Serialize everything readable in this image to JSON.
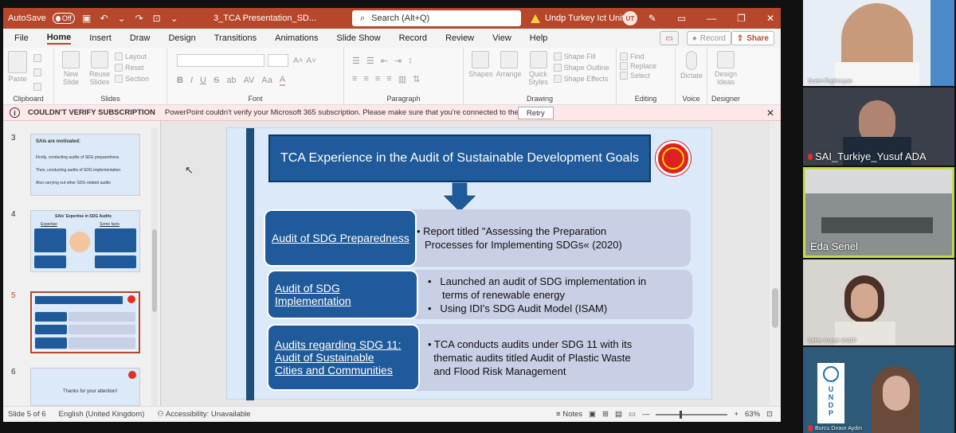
{
  "titlebar": {
    "autosave_label": "AutoSave",
    "autosave_state": "Off",
    "doc_title": "3_TCA Presentation_SD...",
    "search_placeholder": "Search (Alt+Q)",
    "org_label": "Undp Turkey Ict Unit",
    "user_initials": "UT"
  },
  "menu": {
    "items": [
      "File",
      "Home",
      "Insert",
      "Draw",
      "Design",
      "Transitions",
      "Animations",
      "Slide Show",
      "Record",
      "Review",
      "View",
      "Help"
    ],
    "active": "Home",
    "record_label": "Record",
    "share_label": "Share"
  },
  "ribbon": {
    "clipboard": {
      "label": "Clipboard",
      "paste": "Paste"
    },
    "slides": {
      "label": "Slides",
      "new_slide": "New Slide",
      "reuse_slides": "Reuse Slides",
      "layout": "Layout",
      "reset": "Reset",
      "section": "Section"
    },
    "font": {
      "label": "Font",
      "buttons": [
        "B",
        "I",
        "U",
        "S",
        "ab",
        "AV",
        "Aa",
        "A"
      ]
    },
    "paragraph": {
      "label": "Paragraph"
    },
    "drawing": {
      "label": "Drawing",
      "shapes": "Shapes",
      "arrange": "Arrange",
      "quick_styles": "Quick Styles",
      "shape_fill": "Shape Fill",
      "shape_outline": "Shape Outline",
      "shape_effects": "Shape Effects"
    },
    "editing": {
      "label": "Editing",
      "find": "Find",
      "replace": "Replace",
      "select": "Select"
    },
    "voice": {
      "label": "Voice",
      "dictate": "Dictate"
    },
    "designer": {
      "label": "Designer",
      "design_ideas": "Design Ideas"
    }
  },
  "notice": {
    "title": "COULDN'T VERIFY SUBSCRIPTION",
    "message": "PowerPoint couldn't verify your Microsoft 365 subscription. Please make sure that you're connected to the Internet.",
    "retry_label": "Retry"
  },
  "thumbnails": [
    {
      "num": "3",
      "title": "SAIs are motivated:",
      "lines": [
        "Firstly, conducting audits of SDG preparedness",
        "Then, conducting audits of SDG implementation",
        "Also carrying out other SDG-related audits"
      ]
    },
    {
      "num": "4",
      "title": "SAIs' Expertise in SDG Audits",
      "lines": [
        "Expertise",
        "Some facts"
      ]
    },
    {
      "num": "5",
      "title": "TCA Experience in the Audit of Sustainable Development Goals",
      "lines": []
    },
    {
      "num": "6",
      "title": "Thanks for your attention!",
      "lines": []
    }
  ],
  "selected_slide": "5",
  "slide": {
    "title": "TCA Experience in the Audit of Sustainable Development Goals",
    "rows": [
      {
        "label": "Audit of SDG Preparedness",
        "content": [
          "• Report titled \"Assessing the Preparation",
          "Processes for Implementing SDGs« (2020)"
        ]
      },
      {
        "label": "Audit of SDG Implementation",
        "content": [
          "•   Launched an audit of SDG implementation in",
          "     terms of renewable energy",
          "•   Using IDI's SDG Audit Model (ISAM)"
        ]
      },
      {
        "label_lines": [
          "Audits regarding SDG 11:",
          "Audit of Sustainable",
          "Cities and Communities"
        ],
        "content": [
          "• TCA conducts audits under SDG 11 with its",
          "  thematic audits titled Audit of Plastic Waste",
          "  and Flood Risk Management"
        ]
      }
    ]
  },
  "status": {
    "slide_counter": "Slide 5 of 6",
    "language": "English (United Kingdom)",
    "accessibility": "Accessibility: Unavailable",
    "notes": "Notes",
    "zoom": "63%"
  },
  "participants": [
    {
      "name": "Suren Poghosyan",
      "muted": false
    },
    {
      "name": "SAI_Turkiye_Yusuf ADA",
      "muted": true
    },
    {
      "name": "Eda Senel",
      "muted": false,
      "speaker": true
    },
    {
      "name": "Seher Arıner UNDP",
      "muted": false
    },
    {
      "name": "Burcu Dıraor Aydın",
      "muted": true
    }
  ],
  "undp_logo": "U N D P",
  "colors": {
    "ppt_accent": "#b7472a",
    "slide_blue": "#1f5a9a",
    "speaker_border": "#c7d94c"
  }
}
